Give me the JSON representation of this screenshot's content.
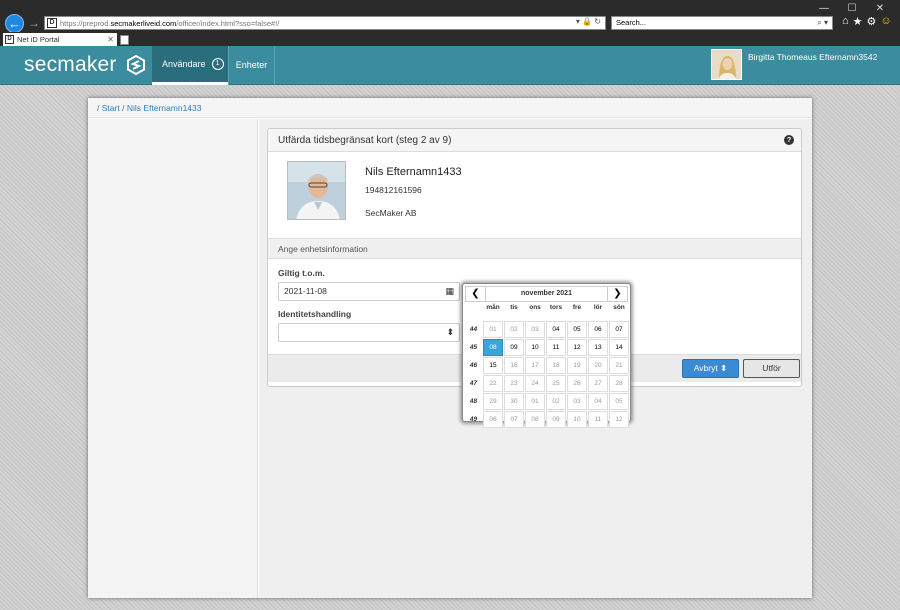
{
  "browser": {
    "url_prefix": "https://preprod.",
    "url_host": "secmakerliveid.com",
    "url_path": "/officer/index.html?sso=false#!/",
    "search_placeholder": "Search...",
    "tab_title": "Net iD Portal",
    "favicon_letter": "D"
  },
  "header": {
    "logo_text": "secmaker",
    "nav_users_label": "Användare",
    "nav_users_badge": "1",
    "nav_units_label": "Enheter",
    "user_name": "Birgitta Thomeaus Efternamn3542"
  },
  "breadcrumb": {
    "sep": "/",
    "start": "Start",
    "current": "Nils Efternamn1433"
  },
  "panel": {
    "title": "Utfärda tidsbegränsat kort (steg 2 av 9)",
    "help": "?",
    "person": {
      "name": "Nils Efternamn1433",
      "personal_number": "194812161596",
      "organization": "SecMaker AB"
    },
    "section_title": "Ange enhetsinformation",
    "valid_to_label": "Giltig t.o.m.",
    "valid_to_value": "2021-11-08",
    "id_document_label": "Identitetshandling",
    "id_document_value": "",
    "cancel_label": "Avbryt",
    "run_label": "Utför"
  },
  "datepicker": {
    "title": "november 2021",
    "weekdays": [
      "mån",
      "tis",
      "ons",
      "tors",
      "fre",
      "lör",
      "sön"
    ],
    "weeks": [
      {
        "wk": "44",
        "days": [
          [
            "01",
            true
          ],
          [
            "02",
            true
          ],
          [
            "03",
            true
          ],
          [
            "04",
            false
          ],
          [
            "05",
            false
          ],
          [
            "06",
            false
          ],
          [
            "07",
            false
          ]
        ]
      },
      {
        "wk": "45",
        "days": [
          [
            "08",
            false
          ],
          [
            "09",
            false
          ],
          [
            "10",
            false
          ],
          [
            "11",
            false
          ],
          [
            "12",
            false
          ],
          [
            "13",
            false
          ],
          [
            "14",
            false
          ]
        ]
      },
      {
        "wk": "46",
        "days": [
          [
            "15",
            false
          ],
          [
            "16",
            true
          ],
          [
            "17",
            true
          ],
          [
            "18",
            true
          ],
          [
            "19",
            true
          ],
          [
            "20",
            true
          ],
          [
            "21",
            true
          ]
        ]
      },
      {
        "wk": "47",
        "days": [
          [
            "22",
            true
          ],
          [
            "23",
            true
          ],
          [
            "24",
            true
          ],
          [
            "25",
            true
          ],
          [
            "26",
            true
          ],
          [
            "27",
            true
          ],
          [
            "28",
            true
          ]
        ]
      },
      {
        "wk": "48",
        "days": [
          [
            "29",
            true
          ],
          [
            "30",
            true
          ],
          [
            "01",
            true
          ],
          [
            "02",
            true
          ],
          [
            "03",
            true
          ],
          [
            "04",
            true
          ],
          [
            "05",
            true
          ]
        ]
      },
      {
        "wk": "49",
        "days": [
          [
            "06",
            true
          ],
          [
            "07",
            true
          ],
          [
            "08",
            true
          ],
          [
            "09",
            true
          ],
          [
            "10",
            true
          ],
          [
            "11",
            true
          ],
          [
            "12",
            true
          ]
        ]
      }
    ],
    "selected": "08"
  },
  "colors": {
    "header_bg": "#3a8c9e",
    "primary_button": "#3b8ad4",
    "selected_day": "#3aa5dc"
  }
}
